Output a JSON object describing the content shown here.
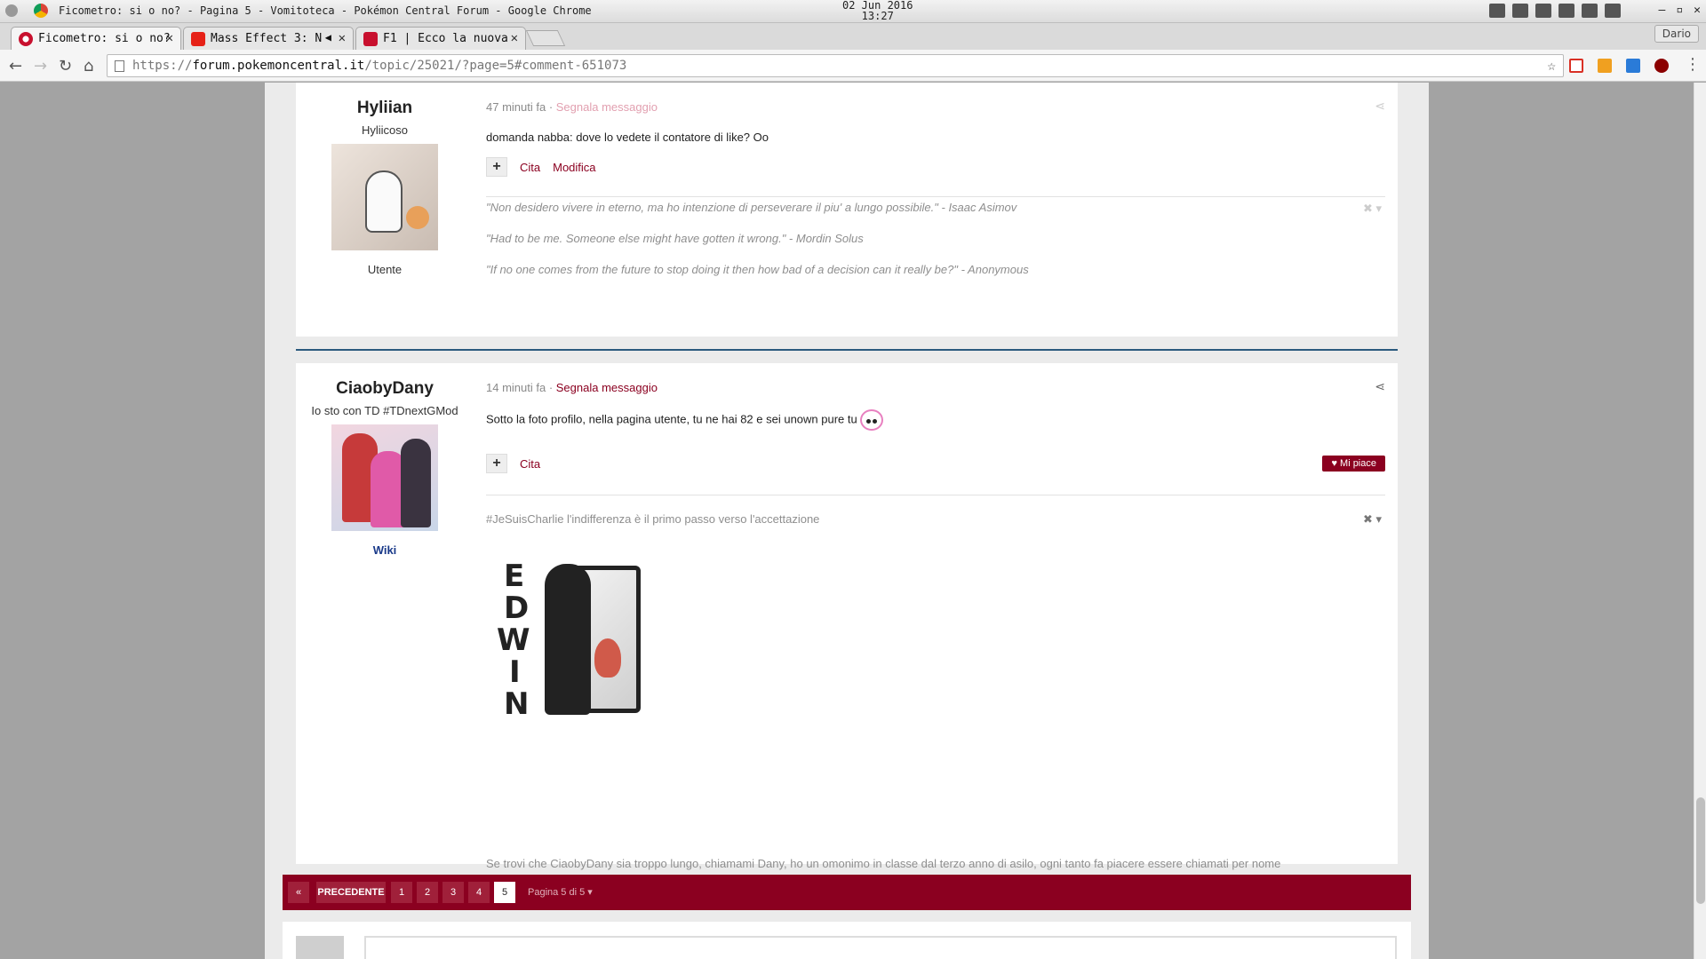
{
  "os": {
    "window_title": "Ficometro: si o no? - Pagina 5 - Vomitoteca - Pokémon Central Forum - Google Chrome",
    "date": "02 Jun 2016",
    "time": "13:27"
  },
  "browser": {
    "tabs": [
      {
        "title": "Ficometro: si o no?",
        "active": true
      },
      {
        "title": "Mass Effect 3: N",
        "active": false
      },
      {
        "title": "F1 | Ecco la nuova",
        "active": false
      }
    ],
    "profile": "Dario",
    "url_scheme": "https://",
    "url_host": "forum.pokemoncentral.it",
    "url_path": "/topic/25021/?page=5#comment-651073"
  },
  "posts": [
    {
      "author": "Hyliian",
      "subtitle": "Hyliicoso",
      "group": "Utente",
      "time": "47 minuti fa",
      "report": "Segnala messaggio",
      "content": "domanda nabba: dove lo vedete il contatore di like? Oo",
      "actions": [
        "Cita",
        "Modifica"
      ],
      "signature": [
        "\"Non desidero vivere in eterno, ma ho intenzione di perseverare il piu' a lungo possibile.\" - Isaac Asimov",
        "\"Had to be me. Someone else might have gotten it wrong.\" - Mordin Solus",
        "\"If no one comes from the future to stop doing it then how bad of a decision can it really be?\" - Anonymous"
      ]
    },
    {
      "author": "CiaobyDany",
      "subtitle": "Io sto con TD #TDnextGMod",
      "link": "Wiki",
      "time": "14 minuti fa",
      "report": "Segnala messaggio",
      "content": "Sotto la foto profilo, nella pagina utente, tu ne hai 82 e sei unown pure tu",
      "actions": [
        "Cita"
      ],
      "like": "Mi piace",
      "signature_top": "#JeSuisCharlie l'indifferenza è il primo passo verso l'accettazione",
      "signature_logo_letters": [
        "E",
        "D",
        "W",
        "I",
        "N"
      ],
      "signature_bottom": "Se trovi che CiaobyDany sia troppo lungo, chiamami Dany, ho un omonimo in classe dal terzo anno di asilo, ogni tanto fa piacere essere chiamati per nome"
    }
  ],
  "pagination": {
    "prev": "PRECEDENTE",
    "pages": [
      "1",
      "2",
      "3",
      "4",
      "5"
    ],
    "current": "5",
    "page_of": "Pagina 5 di 5"
  },
  "colors": {
    "brand": "#8b0020",
    "divider": "#2b5a7e"
  }
}
